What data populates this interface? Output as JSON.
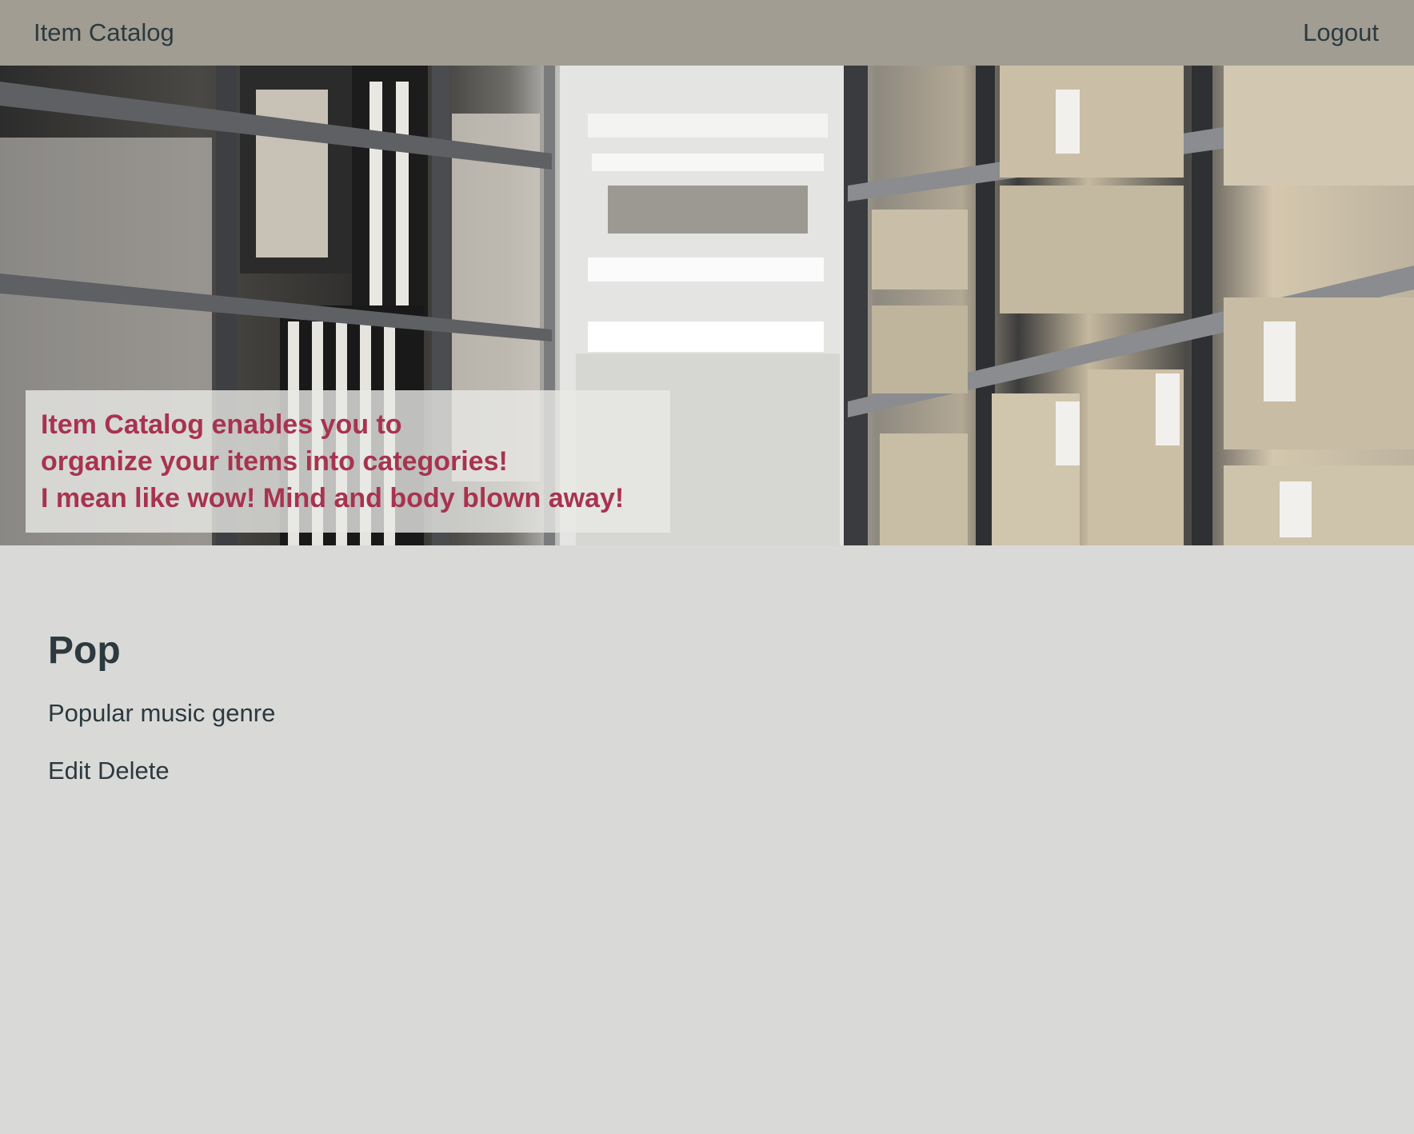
{
  "navbar": {
    "brand": "Item Catalog",
    "logout": "Logout"
  },
  "hero": {
    "lines": [
      "Item Catalog enables you to",
      "organize your items into categories!",
      "I mean like wow! Mind and body blown away!"
    ]
  },
  "category": {
    "title": "Pop",
    "description": "Popular music genre",
    "edit_label": "Edit",
    "delete_label": "Delete"
  },
  "colors": {
    "navbar_bg": "#a19d93",
    "page_bg": "#d9d9d7",
    "text": "#2c3a3f",
    "accent": "#a8334f"
  }
}
